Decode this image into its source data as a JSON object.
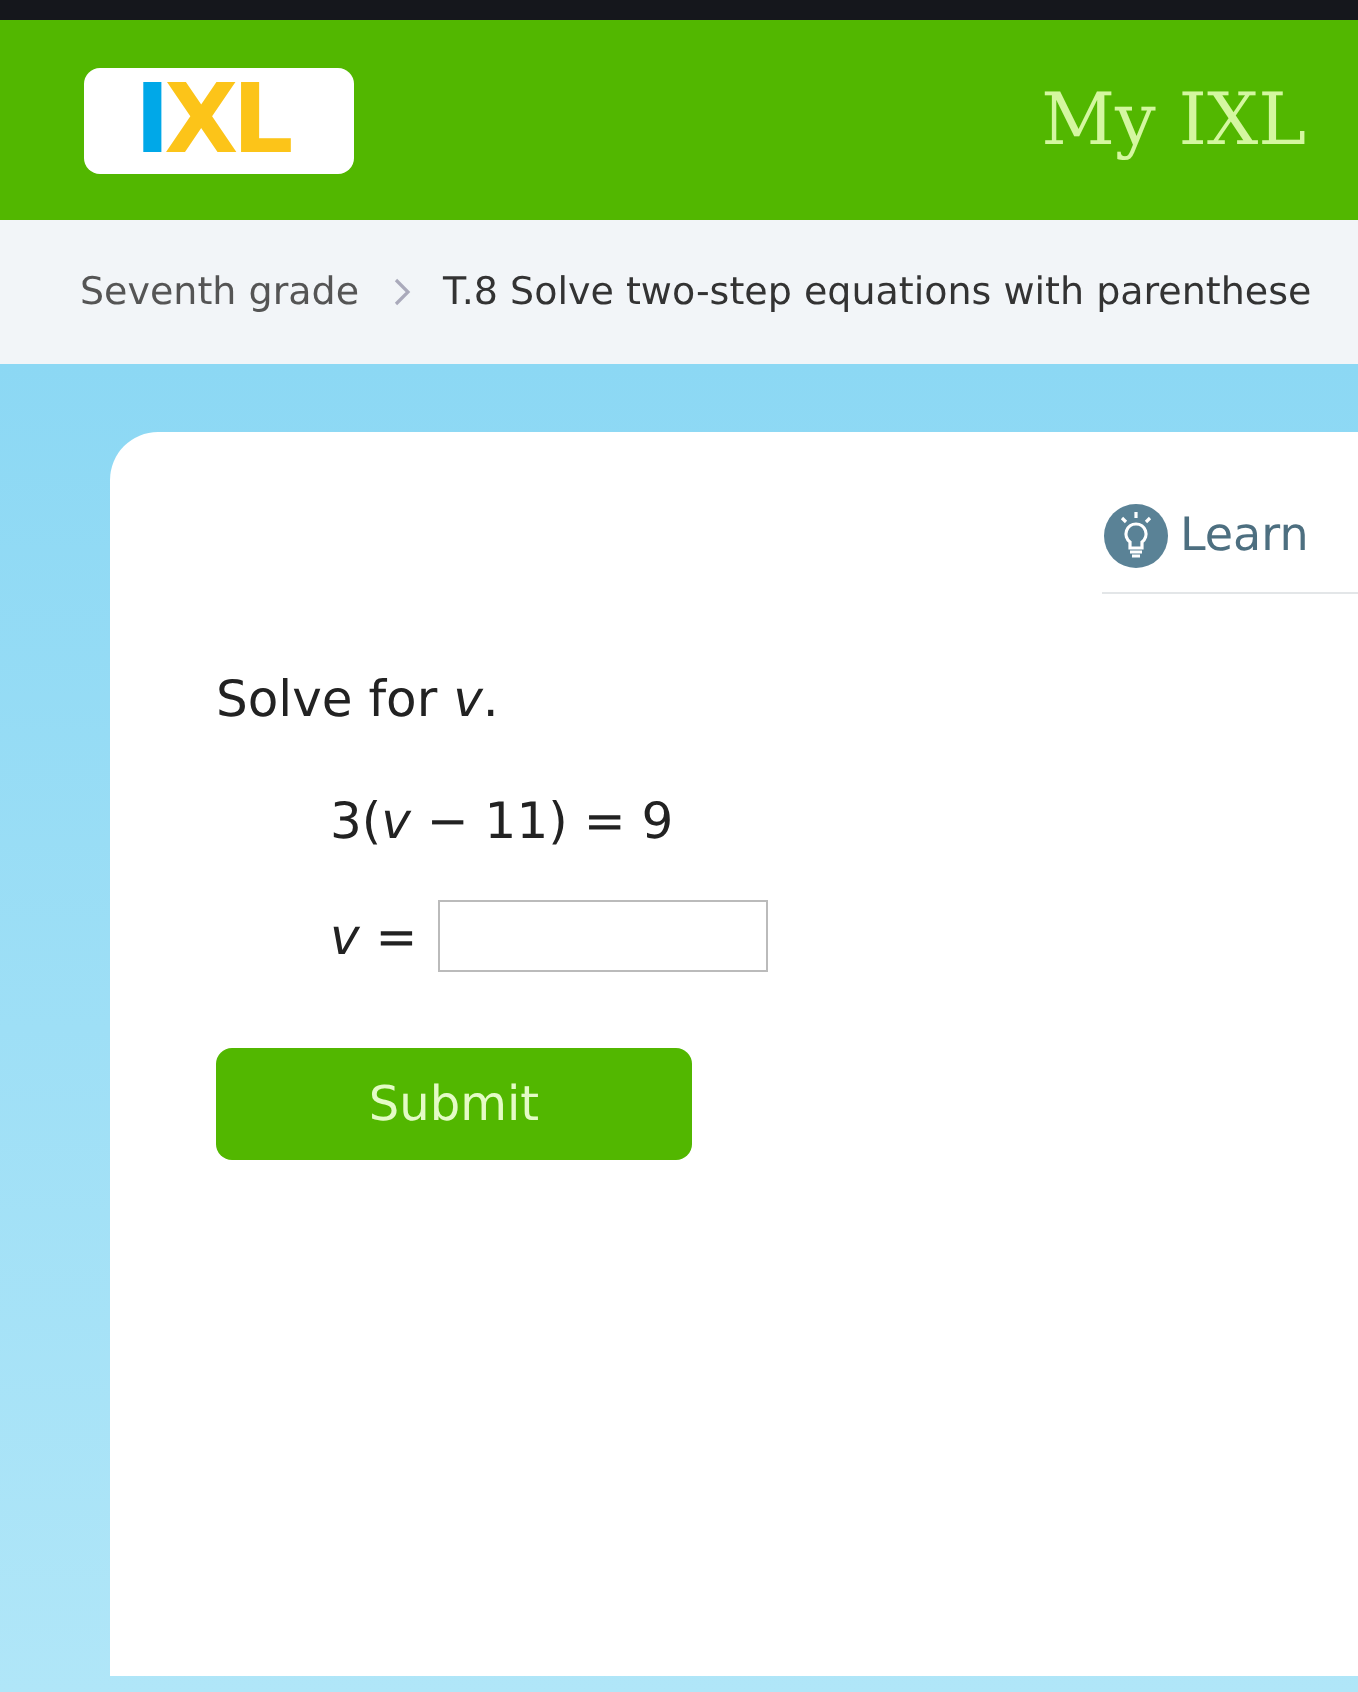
{
  "header": {
    "logo": [
      {
        "letter": "I",
        "color": "#00a8e8"
      },
      {
        "letter": "X",
        "color": "#fcc419"
      },
      {
        "letter": "L",
        "color": "#fcc419"
      }
    ],
    "title": "My IXL"
  },
  "breadcrumb": [
    "Seventh grade",
    "T.8 Solve two-step equations with parenthese"
  ],
  "learn": {
    "label": "Learn"
  },
  "question": {
    "prompt": "Solve for *v*.",
    "equation": "3(*v* − 11) = 9",
    "answer_label": "*v* ="
  },
  "submit": "Submit"
}
